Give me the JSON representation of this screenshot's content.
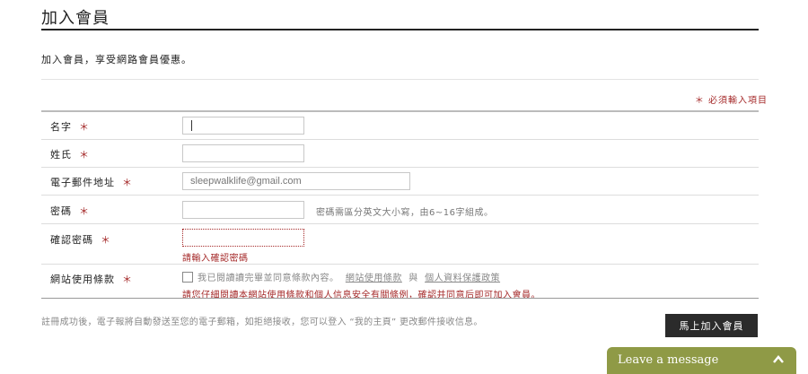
{
  "page": {
    "title": "加入會員",
    "intro": "加入會員，享受網路會員優惠。",
    "required_note": "＊ 必須輸入項目"
  },
  "form": {
    "required_mark": "＊",
    "first_name": {
      "label": "名字",
      "value": ""
    },
    "last_name": {
      "label": "姓氏",
      "value": ""
    },
    "email": {
      "label": "電子郵件地址",
      "value": "sleepwalklife@gmail.com"
    },
    "password": {
      "label": "密碼",
      "value": "",
      "hint": "密碼需區分英文大小寫，由6~16字組成。"
    },
    "confirm_password": {
      "label": "確認密碼",
      "value": "",
      "error": "請輸入確認密碼"
    },
    "terms": {
      "label": "網站使用條款",
      "checked": false,
      "text_prefix": "我已閱讀讀完畢並同意條款內容。",
      "link_terms": "網站使用條款",
      "conjunction": "與",
      "link_privacy": "個人資料保護政策",
      "error": "請您仔細閱讀本網站使用條款和個人信息安全有關條例，確認并同意后即可加入會員。"
    }
  },
  "footer": {
    "note": "註冊成功後，電子報將自動發送至您的電子郵箱，如拒絕接收，您可以登入 “我的主頁” 更改郵件接收信息。",
    "join_button": "馬上加入會員"
  },
  "chat": {
    "label": "Leave a message",
    "icon": "chevron-up-icon",
    "color": "#8f9a46"
  }
}
